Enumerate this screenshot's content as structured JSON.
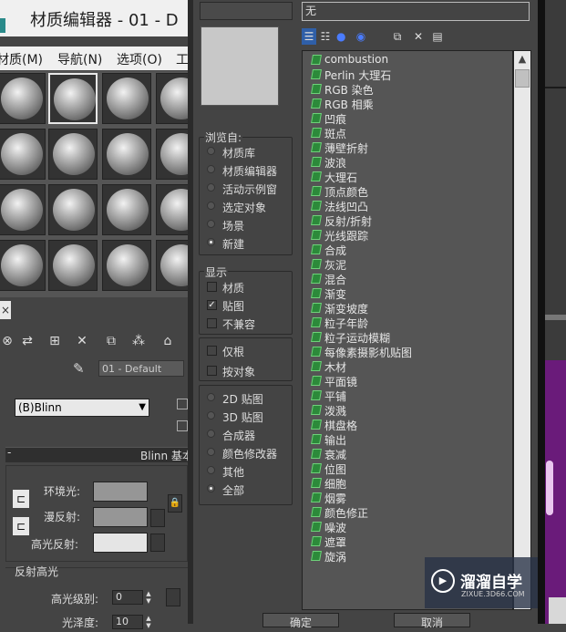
{
  "material_editor": {
    "title": "材质编辑器 - 01 - D",
    "menu": [
      "材质(M)",
      "导航(N)",
      "选项(O)",
      "工"
    ],
    "close_glyph": "×",
    "material_name": "01 - Default",
    "shader": "(B)Blinn",
    "blinn_panel_title": "Blinn 基本",
    "blinn_panel_toggle": "-",
    "color_labels": {
      "ambient": "环境光:",
      "diffuse": "漫反射:",
      "specular": "高光反射:"
    },
    "swatch_colors": {
      "ambient": "#969696",
      "diffuse": "#969696",
      "specular": "#e5e5e5"
    },
    "specular_group_title": "反射高光",
    "specular_level_label": "高光级别:",
    "specular_level_value": "0",
    "glossiness_label": "光泽度:",
    "glossiness_value": "10"
  },
  "browser_dialog": {
    "search_value": "无",
    "browse_from": {
      "title": "浏览自:",
      "options": [
        "材质库",
        "材质编辑器",
        "活动示例窗",
        "选定对象",
        "场景",
        "新建"
      ],
      "selected_index": 5
    },
    "show": {
      "title": "显示",
      "options": [
        {
          "label": "材质",
          "checked": false
        },
        {
          "label": "贴图",
          "checked": true
        },
        {
          "label": "不兼容",
          "checked": false
        }
      ]
    },
    "filters": [
      {
        "label": "仅根",
        "checked": false
      },
      {
        "label": "按对象",
        "checked": false
      }
    ],
    "map_types": {
      "options": [
        "2D 贴图",
        "3D 贴图",
        "合成器",
        "颜色修改器",
        "其他",
        "全部"
      ],
      "selected_index": 5
    },
    "map_list": [
      "combustion",
      "Perlin 大理石",
      "RGB 染色",
      "RGB 相乘",
      "凹痕",
      "斑点",
      "薄壁折射",
      "波浪",
      "大理石",
      "顶点颜色",
      "法线凹凸",
      "反射/折射",
      "光线跟踪",
      "合成",
      "灰泥",
      "混合",
      "渐变",
      "渐变坡度",
      "粒子年龄",
      "粒子运动模糊",
      "每像素摄影机贴图",
      "木材",
      "平面镜",
      "平铺",
      "泼溅",
      "棋盘格",
      "输出",
      "衰减",
      "位图",
      "细胞",
      "烟雾",
      "颜色修正",
      "噪波",
      "遮罩",
      "旋涡"
    ],
    "ok_label": "确定",
    "cancel_label": "取消"
  },
  "watermark": {
    "name": "溜溜自学",
    "url": "ZIXUE.3D66.COM"
  }
}
